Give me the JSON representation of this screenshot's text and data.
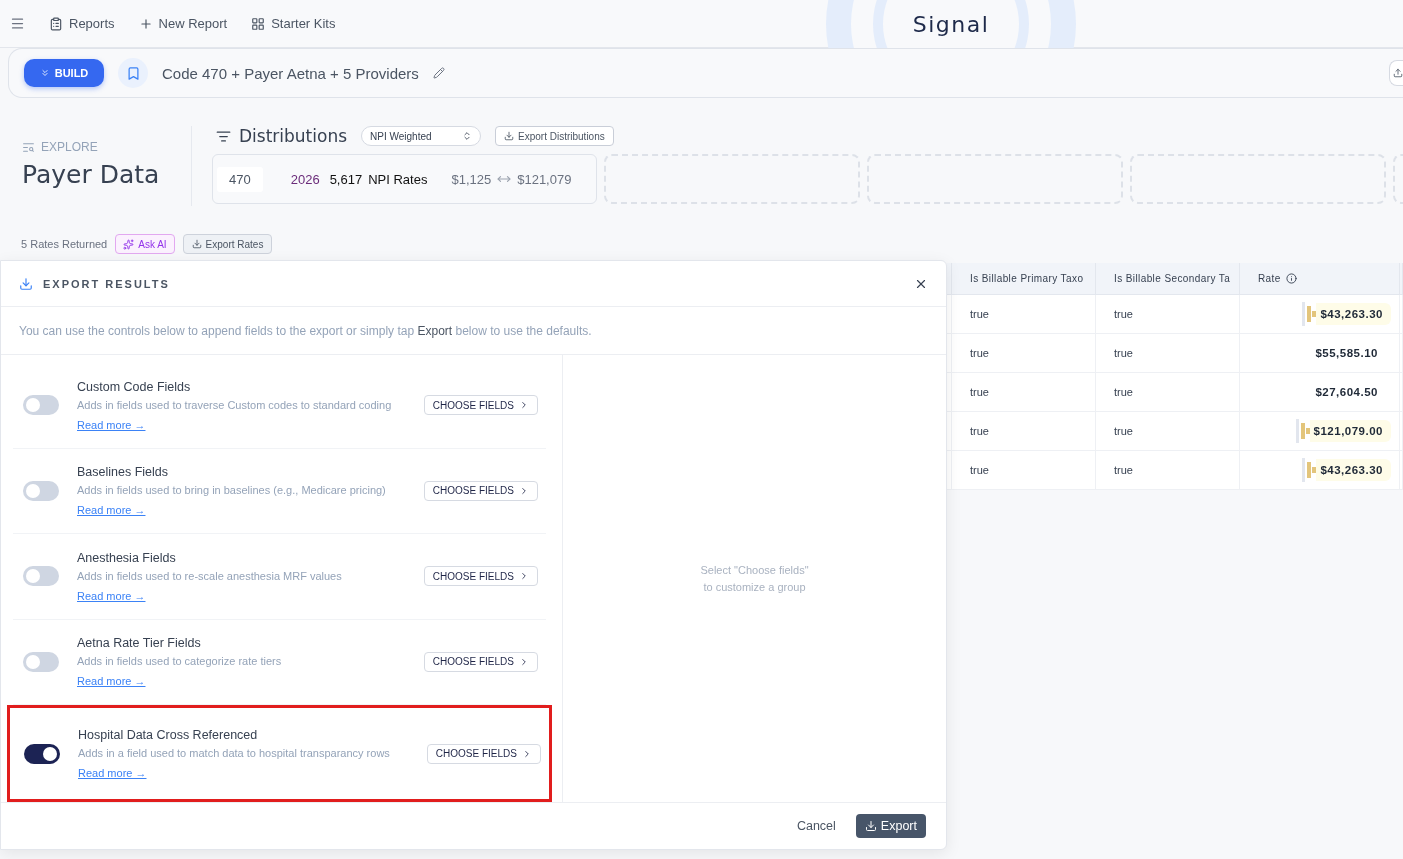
{
  "nav": {
    "items": [
      {
        "kind": "reports",
        "label": "Reports"
      },
      {
        "kind": "new",
        "label": "New Report"
      },
      {
        "kind": "kits",
        "label": "Starter Kits"
      }
    ],
    "logo": "Signal"
  },
  "report_bar": {
    "build_label": "BUILD",
    "title": "Code 470 + Payer Aetna + 5 Providers"
  },
  "explore": {
    "eyebrow": "EXPLORE",
    "title": "Payer Data"
  },
  "distributions": {
    "title": "Distributions",
    "weighting": "NPI Weighted",
    "export_label": "Export Distributions",
    "card": {
      "code": "470",
      "year": "2026",
      "count": "5,617",
      "count_label": "NPI Rates",
      "min": "$1,125",
      "max": "$121,079"
    }
  },
  "results": {
    "count": "5",
    "label": "Rates Returned",
    "ask_ai": "Ask AI",
    "export_rates": "Export Rates"
  },
  "export_dialog": {
    "title": "EXPORT RESULTS",
    "intro": "You can use the controls below to append fields to the export or simply tap **Export** below to use the defaults.",
    "groups": [
      {
        "title": "Custom Code Fields",
        "description": "Adds in fields used to traverse Custom codes to standard coding",
        "on": false,
        "highlighted": false,
        "choose_label": "CHOOSE FIELDS",
        "link": "Read more →"
      },
      {
        "title": "Baselines Fields",
        "description": "Adds in fields used to bring in baselines (e.g., Medicare pricing)",
        "on": false,
        "highlighted": false,
        "choose_label": "CHOOSE FIELDS",
        "link": "Read more →"
      },
      {
        "title": "Anesthesia Fields",
        "description": "Adds in fields used to re-scale anesthesia MRF values",
        "on": false,
        "highlighted": false,
        "choose_label": "CHOOSE FIELDS",
        "link": "Read more →"
      },
      {
        "title": "Aetna Rate Tier Fields",
        "description": "Adds in fields used to categorize rate tiers",
        "on": false,
        "highlighted": false,
        "choose_label": "CHOOSE FIELDS",
        "link": "Read more →"
      },
      {
        "title": "Hospital Data Cross Referenced",
        "description": "Adds in a field used to match data to hospital transparancy rows",
        "on": true,
        "highlighted": true,
        "choose_label": "CHOOSE FIELDS",
        "link": "Read more →"
      }
    ],
    "empty_hint": [
      "Select \"Choose fields\"",
      "to customize a group"
    ],
    "cancel": "Cancel",
    "export": "Export"
  },
  "table": {
    "columns": [
      "Is Billable Primary Taxo",
      "Is Billable Secondary Ta",
      "Rate"
    ],
    "rows": [
      {
        "primary": "true",
        "secondary": "true",
        "rate": "$43,263.30",
        "marker": true
      },
      {
        "primary": "true",
        "secondary": "true",
        "rate": "$55,585.10",
        "marker": false
      },
      {
        "primary": "true",
        "secondary": "true",
        "rate": "$27,604.50",
        "marker": false
      },
      {
        "primary": "true",
        "secondary": "true",
        "rate": "$121,079.00",
        "marker": true
      },
      {
        "primary": "true",
        "secondary": "true",
        "rate": "$43,263.30",
        "marker": true
      }
    ]
  }
}
